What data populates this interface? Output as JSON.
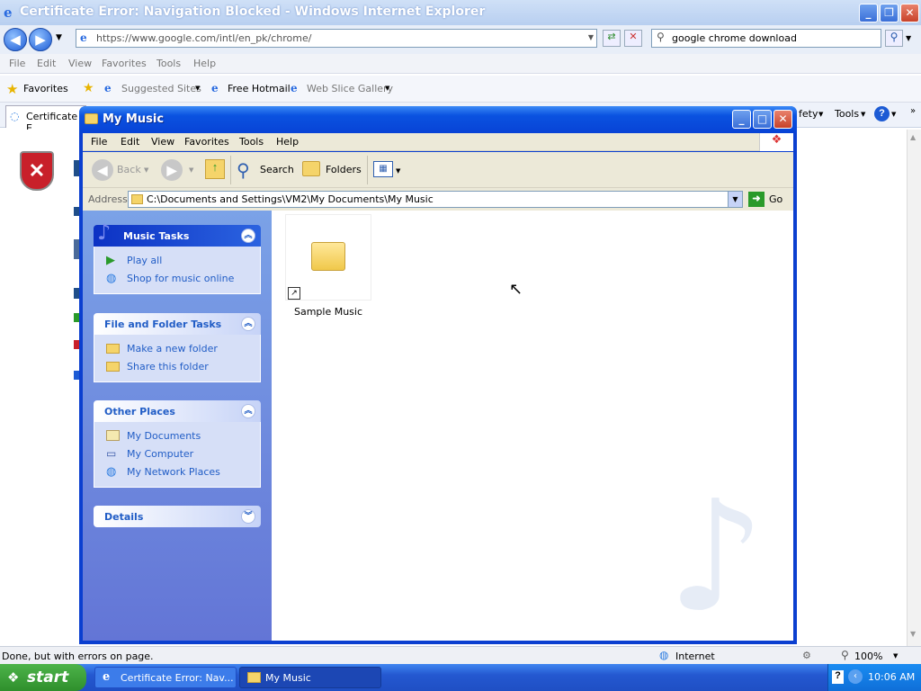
{
  "ie": {
    "title": "Certificate Error: Navigation Blocked - Windows Internet Explorer",
    "url": "https://www.google.com/intl/en_pk/chrome/",
    "search_value": "google chrome download",
    "menu": [
      "File",
      "Edit",
      "View",
      "Favorites",
      "Tools",
      "Help"
    ],
    "favorites_label": "Favorites",
    "suggested_sites": "Suggested Sites",
    "free_hotmail": "Free Hotmail",
    "web_slice_gallery": "Web Slice Gallery",
    "tab_label": "Certificate E",
    "cmd_safety": "fety",
    "cmd_tools": "Tools",
    "status_text": "Done, but with errors on page.",
    "zone": "Internet",
    "zoom": "100%"
  },
  "explorer": {
    "title": "My Music",
    "menu": [
      "File",
      "Edit",
      "View",
      "Favorites",
      "Tools",
      "Help"
    ],
    "back": "Back",
    "search": "Search",
    "folders": "Folders",
    "address_label": "Address",
    "address": "C:\\Documents and Settings\\VM2\\My Documents\\My Music",
    "go": "Go",
    "panels": {
      "music_tasks": {
        "title": "Music Tasks",
        "items": [
          "Play all",
          "Shop for music online"
        ]
      },
      "file_folder_tasks": {
        "title": "File and Folder Tasks",
        "items": [
          "Make a new folder",
          "Share this folder"
        ]
      },
      "other_places": {
        "title": "Other Places",
        "items": [
          "My Documents",
          "My Computer",
          "My Network Places"
        ]
      },
      "details": {
        "title": "Details"
      }
    },
    "files": [
      {
        "name": "Sample Music"
      }
    ]
  },
  "taskbar": {
    "start": "start",
    "tasks": [
      "Certificate Error: Nav...",
      "My Music"
    ],
    "clock": "10:06 AM"
  }
}
